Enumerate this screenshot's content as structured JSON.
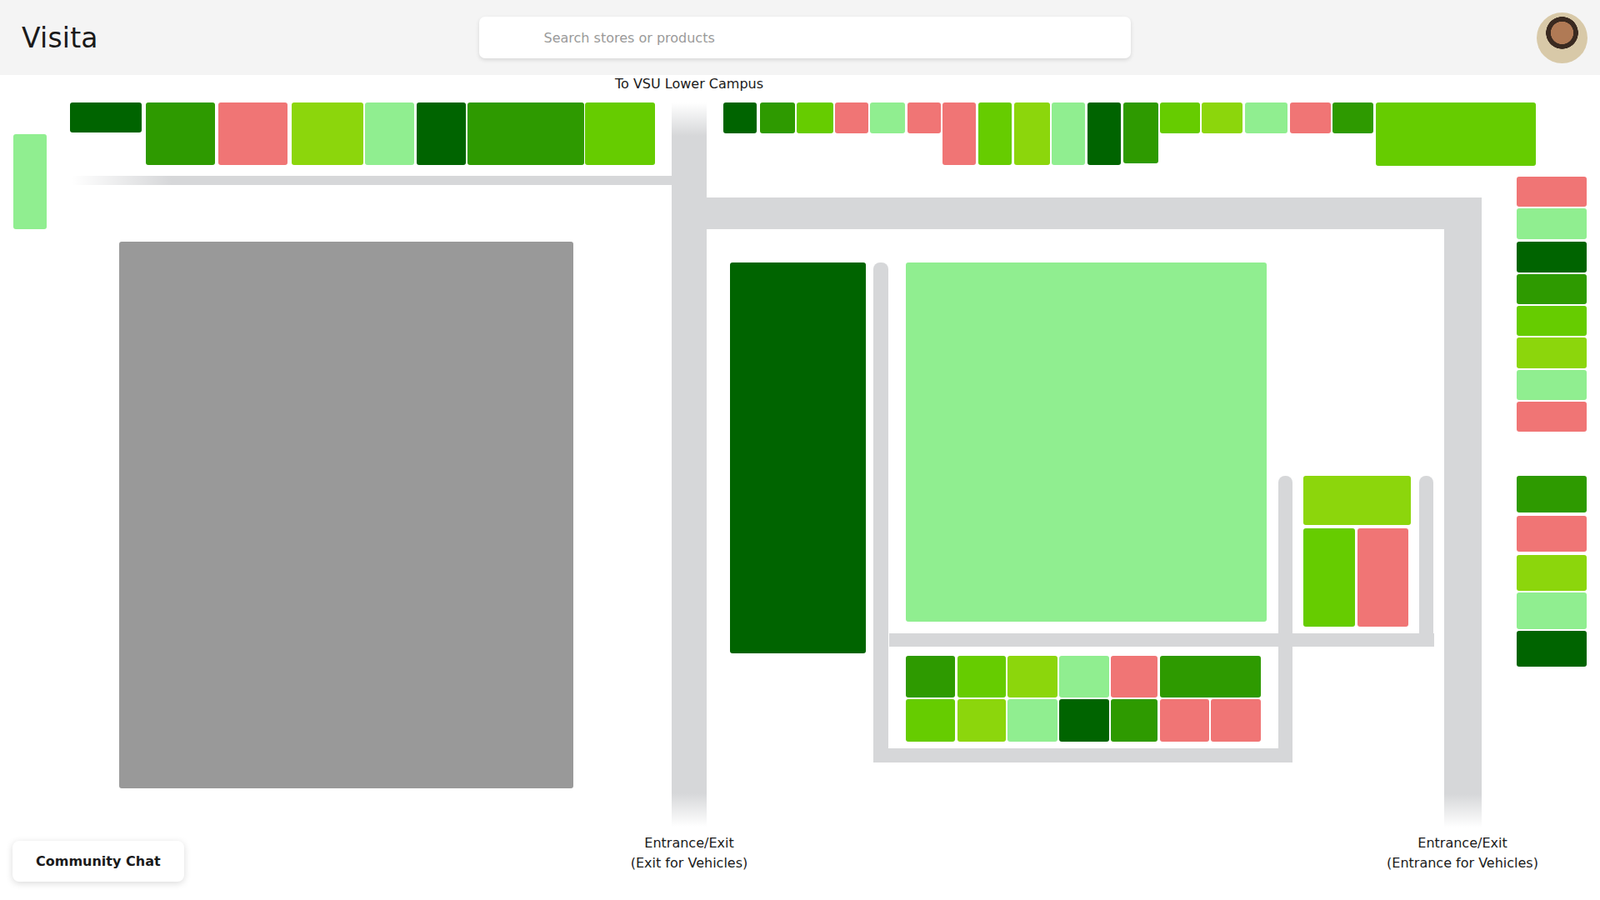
{
  "header": {
    "logo": "Visita",
    "search": {
      "placeholder": "Search stores or products"
    }
  },
  "map": {
    "top_label": "To VSU Lower Campus",
    "entrances": [
      {
        "title": "Entrance/Exit",
        "note": "(Exit for Vehicles)"
      },
      {
        "title": "Entrance/Exit",
        "note": "(Entrance for Vehicles)"
      }
    ],
    "stores": [
      {
        "color": "#90ee90"
      },
      {
        "color": "#006400"
      },
      {
        "color": "#2e9a00"
      },
      {
        "color": "#f07575"
      },
      {
        "color": "#8cd60c"
      },
      {
        "color": "#90ee90"
      },
      {
        "color": "#006400"
      },
      {
        "color": "#2e9a00"
      },
      {
        "color": "#66cc00"
      },
      {
        "color": "#006400"
      },
      {
        "color": "#2e9a00"
      },
      {
        "color": "#66cc00"
      },
      {
        "color": "#f07575"
      },
      {
        "color": "#90ee90"
      },
      {
        "color": "#f07575"
      },
      {
        "color": "#f07575"
      },
      {
        "color": "#66cc00"
      },
      {
        "color": "#8cd60c"
      },
      {
        "color": "#90ee90"
      },
      {
        "color": "#006400"
      },
      {
        "color": "#2e9a00"
      },
      {
        "color": "#66cc00"
      },
      {
        "color": "#8cd60c"
      },
      {
        "color": "#90ee90"
      },
      {
        "color": "#f07575"
      },
      {
        "color": "#2e9a00"
      },
      {
        "color": "#66cc00"
      },
      {
        "color": "#f07575"
      },
      {
        "color": "#90ee90"
      },
      {
        "color": "#006400"
      },
      {
        "color": "#2e9a00"
      },
      {
        "color": "#66cc00"
      },
      {
        "color": "#8cd60c"
      },
      {
        "color": "#90ee90"
      },
      {
        "color": "#f07575"
      },
      {
        "color": "#2e9a00"
      },
      {
        "color": "#f07575"
      },
      {
        "color": "#8cd60c"
      },
      {
        "color": "#90ee90"
      },
      {
        "color": "#006400"
      },
      {
        "color": "#999999"
      },
      {
        "color": "#006400"
      },
      {
        "color": "#90ee90"
      },
      {
        "color": "#8cd60c"
      },
      {
        "color": "#66cc00"
      },
      {
        "color": "#f07575"
      },
      {
        "color": "#2e9a00"
      },
      {
        "color": "#66cc00"
      },
      {
        "color": "#8cd60c"
      },
      {
        "color": "#90ee90"
      },
      {
        "color": "#f07575"
      },
      {
        "color": "#2e9a00"
      },
      {
        "color": "#66cc00"
      },
      {
        "color": "#8cd60c"
      },
      {
        "color": "#90ee90"
      },
      {
        "color": "#006400"
      },
      {
        "color": "#2e9a00"
      },
      {
        "color": "#f07575"
      },
      {
        "color": "#f07575"
      }
    ]
  },
  "community_chat": {
    "label": "Community Chat"
  }
}
